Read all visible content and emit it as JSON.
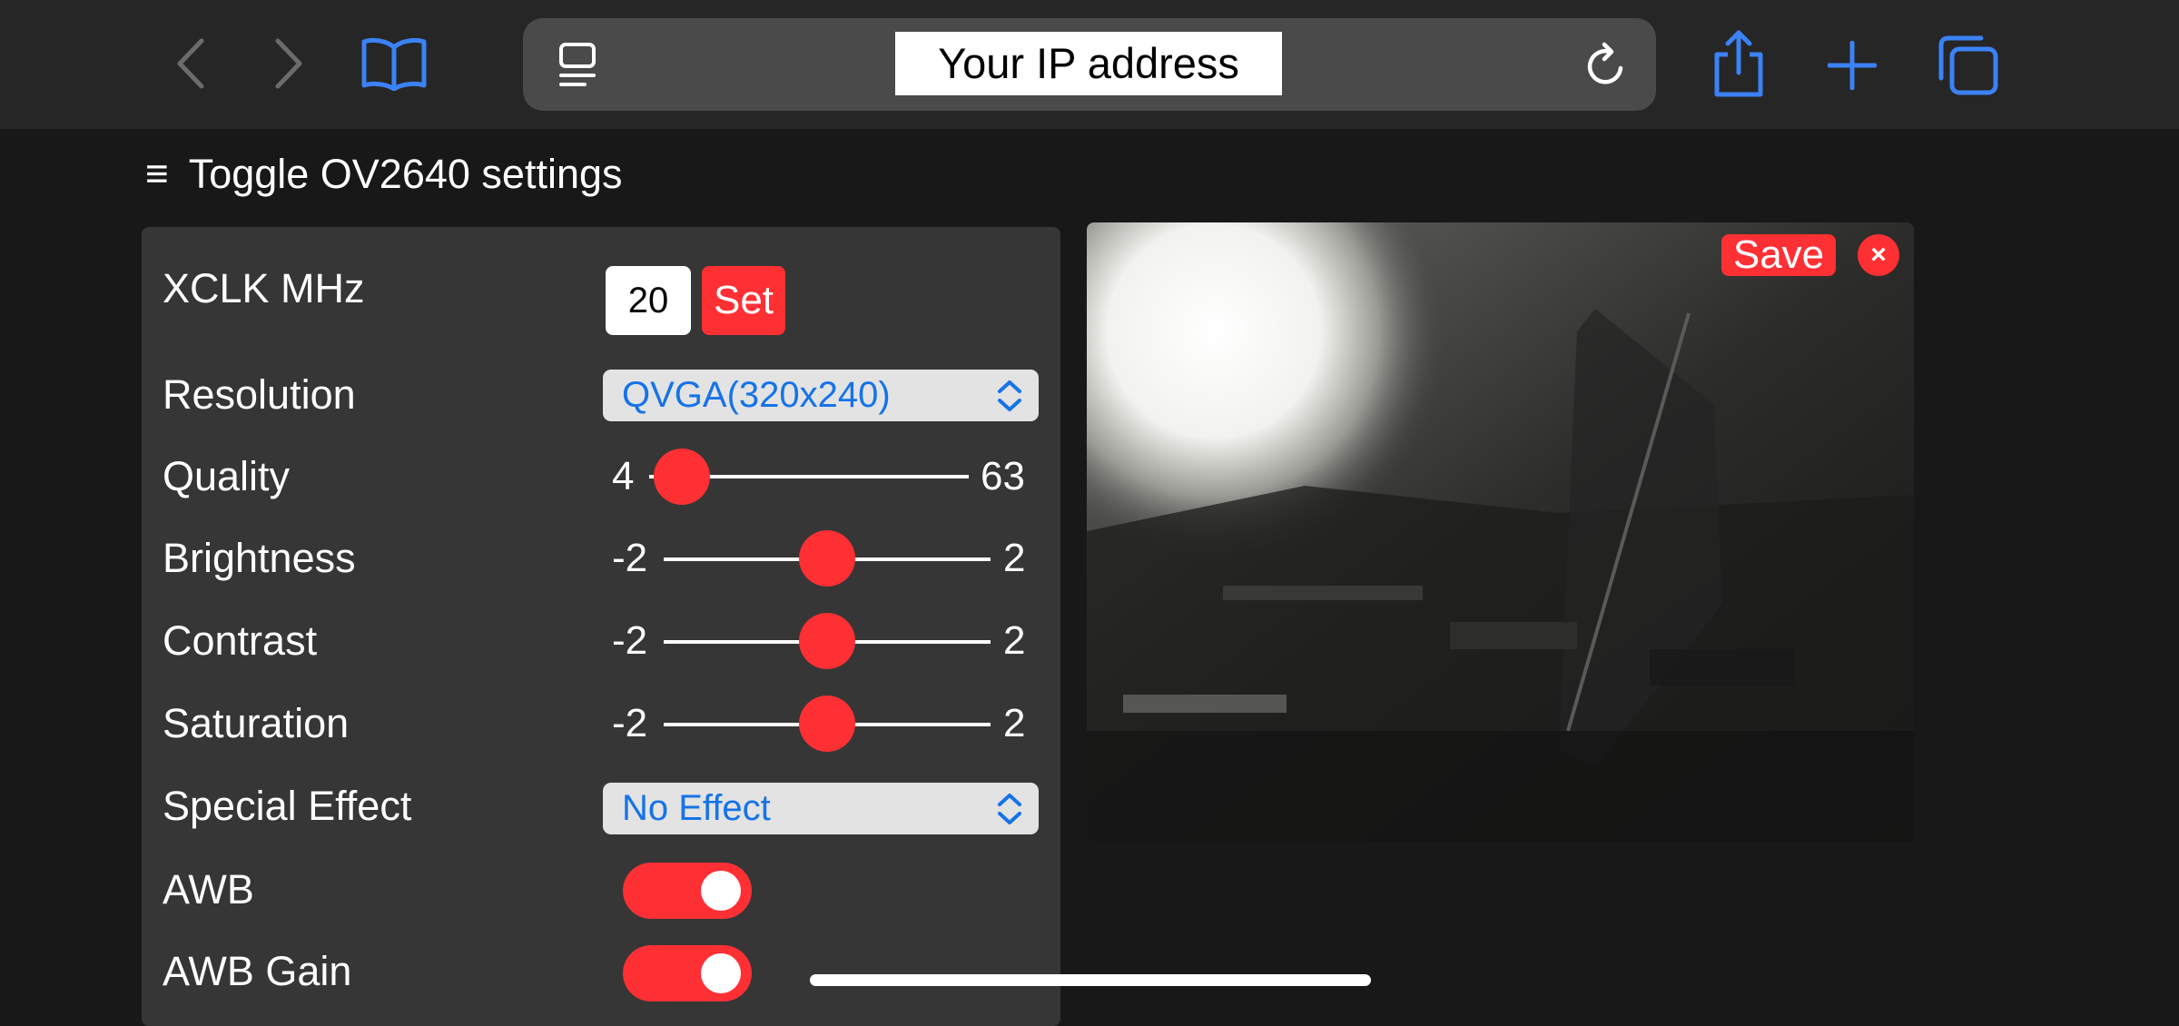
{
  "browser": {
    "url_text": "Your IP address",
    "icons": [
      "back-icon",
      "forward-icon",
      "bookmarks-icon",
      "reader-icon",
      "reload-icon",
      "share-icon",
      "new-tab-icon",
      "tabs-icon"
    ]
  },
  "toggle": {
    "menu_glyph": "≡",
    "label": "Toggle OV2640 settings"
  },
  "settings": {
    "xclk": {
      "label": "XCLK MHz",
      "value": "20",
      "button": "Set"
    },
    "resolution": {
      "label": "Resolution",
      "selected": "QVGA(320x240)"
    },
    "quality": {
      "label": "Quality",
      "min": "4",
      "max": "63",
      "value": 10
    },
    "brightness": {
      "label": "Brightness",
      "min": "-2",
      "max": "2",
      "value": 0
    },
    "contrast": {
      "label": "Contrast",
      "min": "-2",
      "max": "2",
      "value": 0
    },
    "saturation": {
      "label": "Saturation",
      "min": "-2",
      "max": "2",
      "value": 0
    },
    "special_effect": {
      "label": "Special Effect",
      "selected": "No Effect"
    },
    "awb": {
      "label": "AWB",
      "on": true
    },
    "awb_gain": {
      "label": "AWB Gain",
      "on": true
    }
  },
  "stream": {
    "save_label": "Save",
    "close_glyph": "×"
  },
  "colors": {
    "accent": "#ff3034",
    "link_blue": "#1673e8",
    "chrome_blue": "#3b82f6",
    "page_bg": "#181818",
    "panel_bg": "#363636"
  }
}
